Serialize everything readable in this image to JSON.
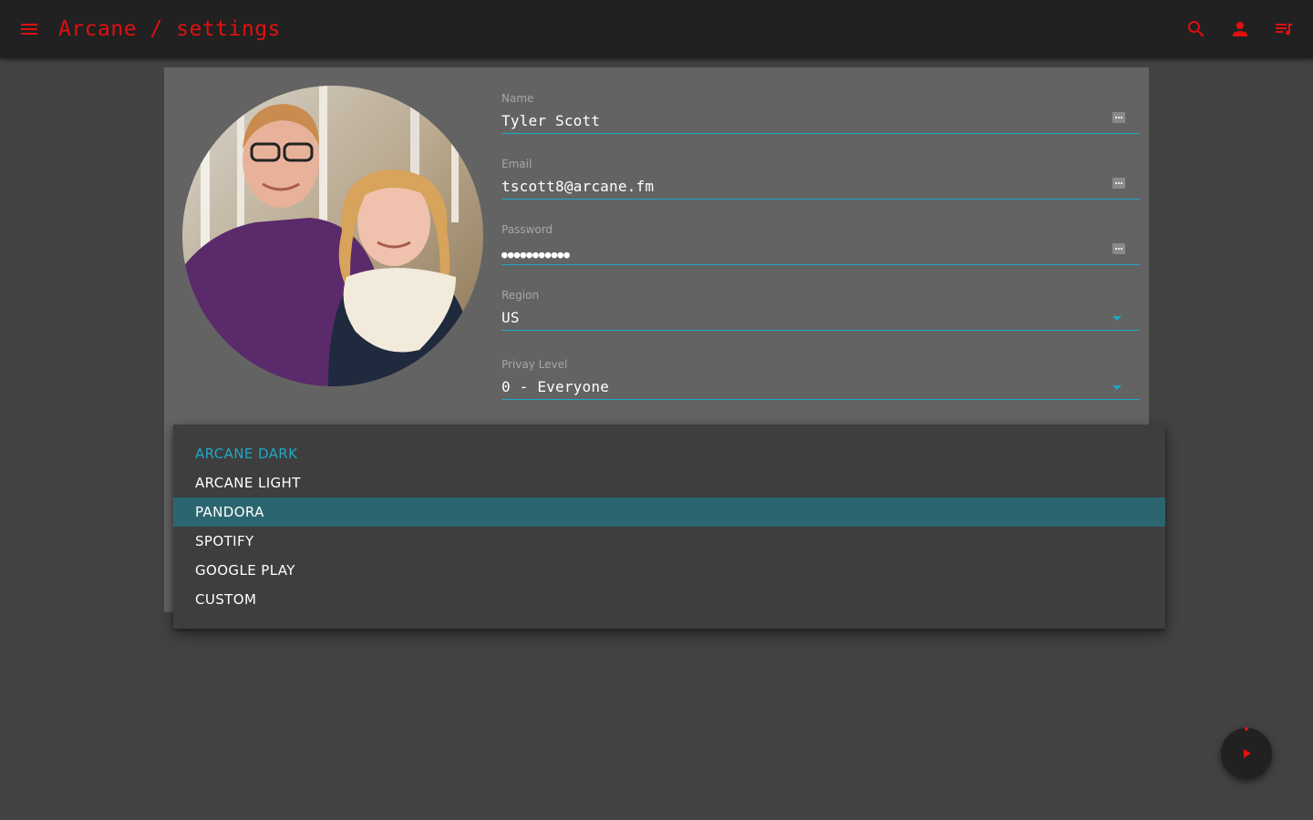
{
  "appbar": {
    "title": "Arcane / settings",
    "icons": [
      "menu-icon",
      "search-icon",
      "account-icon",
      "queue-music-icon"
    ],
    "accent_color": "#e01010"
  },
  "profile": {
    "avatar": "profile-photo"
  },
  "form": {
    "name": {
      "label": "Name",
      "value": "Tyler Scott"
    },
    "email": {
      "label": "Email",
      "value": "tscott8@arcane.fm"
    },
    "password": {
      "label": "Password",
      "value": "●●●●●●●●●●●"
    },
    "region": {
      "label": "Region",
      "value": "US"
    },
    "privacy": {
      "label": "Privay Level",
      "value": "0 - Everyone"
    },
    "underline_color": "#1fa8c4"
  },
  "theme_menu": {
    "items": [
      "ARCANE DARK",
      "ARCANE LIGHT",
      "PANDORA",
      "SPOTIFY",
      "GOOGLE PLAY",
      "CUSTOM"
    ],
    "selected": "ARCANE DARK",
    "highlighted": "PANDORA",
    "selected_color": "#1fa8c4",
    "highlight_color": "#2b6670"
  },
  "player": {
    "fab_icon": "play-icon"
  }
}
